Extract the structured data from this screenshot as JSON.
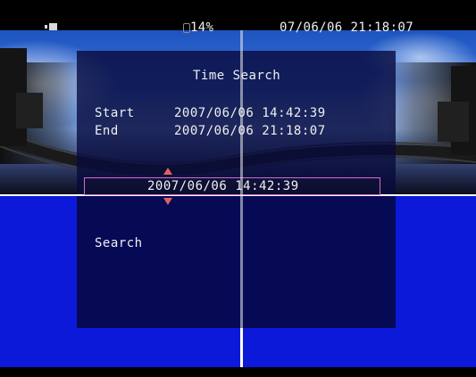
{
  "status_bar": {
    "hdd_icon": "hdd-icon",
    "percent": "14%",
    "datetime": "07/06/06 21:18:07"
  },
  "time_search": {
    "title": "Time Search",
    "start_label": "Start",
    "start_value": "2007/06/06 14:42:39",
    "end_label": "End",
    "end_value": "2007/06/06 21:18:07",
    "search_time_value": "2007/06/06 14:42:39",
    "spinner_up_icon": "arrow-up-icon",
    "spinner_down_icon": "arrow-down-icon",
    "search_label": "Search"
  },
  "colors": {
    "panel": "#060a55",
    "background_blue": "#0c19d8",
    "selection_border": "#d06ad6",
    "spinner_arrow": "#e06060",
    "text": "#f0f0f0"
  }
}
